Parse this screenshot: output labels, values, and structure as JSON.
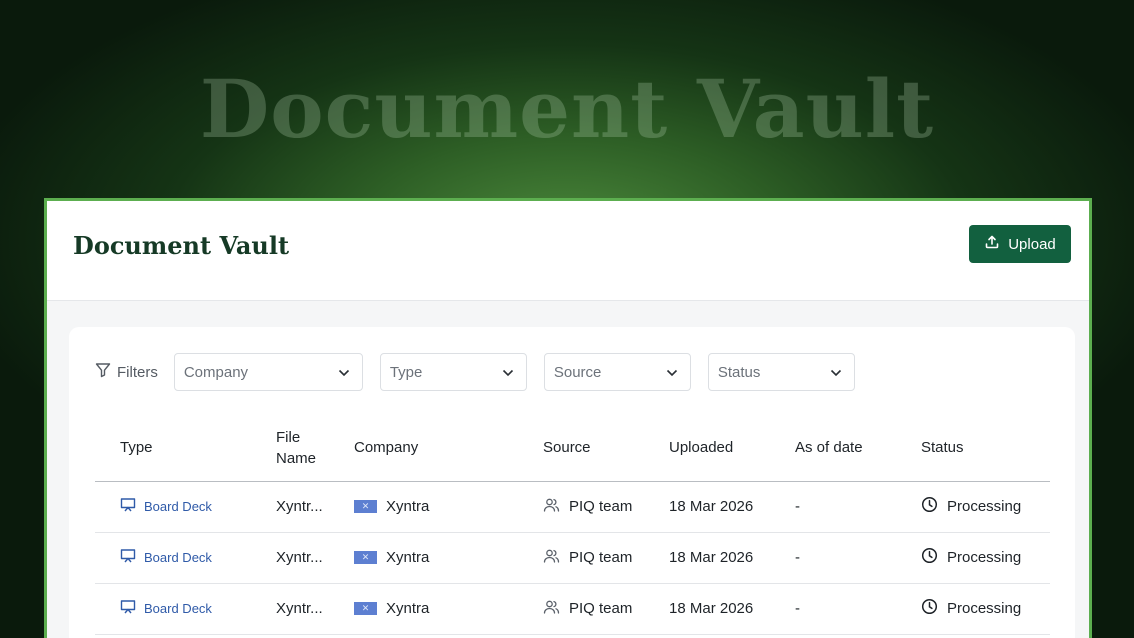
{
  "hero": {
    "title": "Document Vault"
  },
  "header": {
    "title": "Document Vault",
    "upload_label": "Upload"
  },
  "filters": {
    "label": "Filters",
    "selects": [
      {
        "placeholder": "Company"
      },
      {
        "placeholder": "Type"
      },
      {
        "placeholder": "Source"
      },
      {
        "placeholder": "Status"
      }
    ]
  },
  "table": {
    "columns": [
      "Type",
      "File Name",
      "Company",
      "Source",
      "Uploaded",
      "As of date",
      "Status"
    ],
    "rows": [
      {
        "type": "Board Deck",
        "file_name": "Xyntr...",
        "company": "Xyntra",
        "source": "PIQ team",
        "uploaded": "18 Mar 2026",
        "as_of": "-",
        "status": "Processing"
      },
      {
        "type": "Board Deck",
        "file_name": "Xyntr...",
        "company": "Xyntra",
        "source": "PIQ team",
        "uploaded": "18 Mar 2026",
        "as_of": "-",
        "status": "Processing"
      },
      {
        "type": "Board Deck",
        "file_name": "Xyntr...",
        "company": "Xyntra",
        "source": "PIQ team",
        "uploaded": "18 Mar 2026",
        "as_of": "-",
        "status": "Processing"
      }
    ]
  },
  "colors": {
    "accent": "#12603f",
    "frame": "#5cae4f",
    "link": "#2f5aa8"
  }
}
